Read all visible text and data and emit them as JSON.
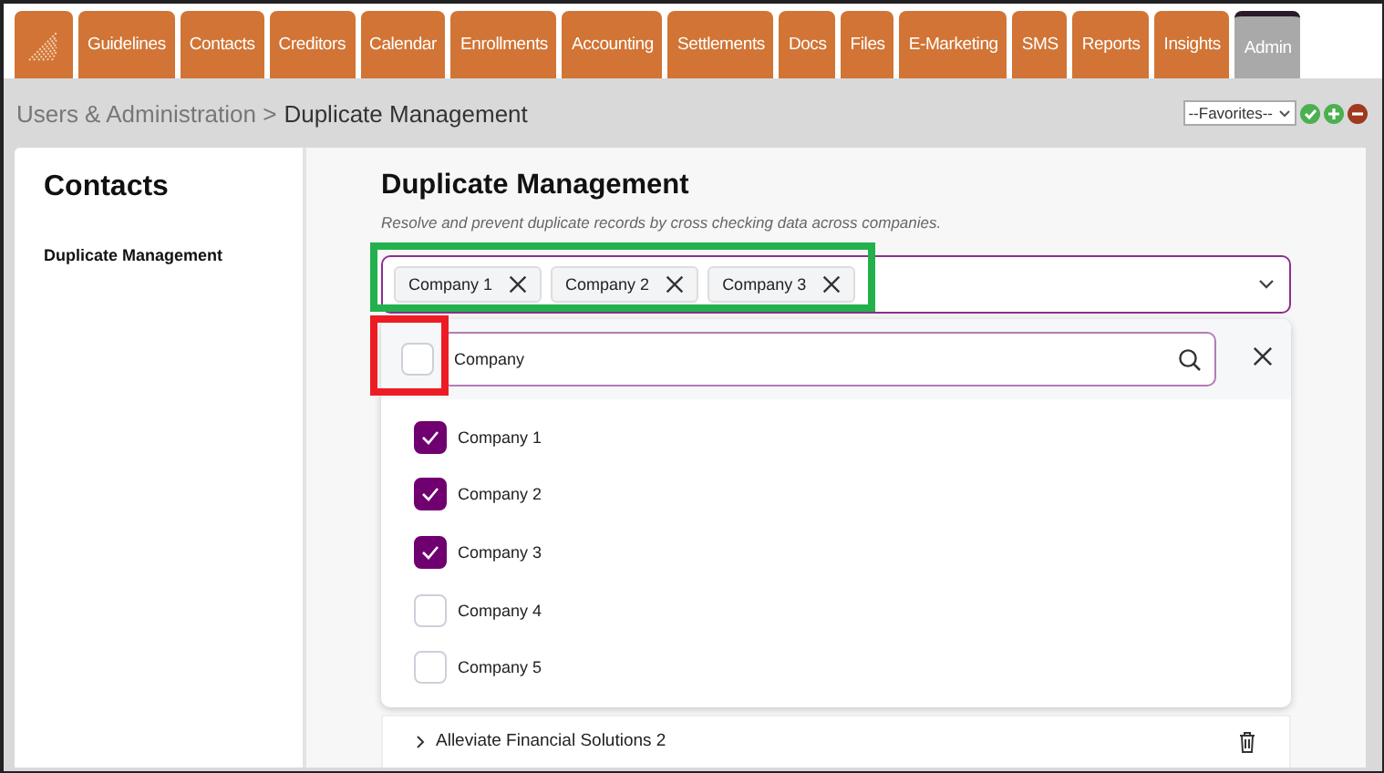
{
  "nav_tabs": [
    {
      "label": "Guidelines",
      "selected": false
    },
    {
      "label": "Contacts",
      "selected": false
    },
    {
      "label": "Creditors",
      "selected": false
    },
    {
      "label": "Calendar",
      "selected": false
    },
    {
      "label": "Enrollments",
      "selected": false
    },
    {
      "label": "Accounting",
      "selected": false
    },
    {
      "label": "Settlements",
      "selected": false
    },
    {
      "label": "Docs",
      "selected": false
    },
    {
      "label": "Files",
      "selected": false
    },
    {
      "label": "E-Marketing",
      "selected": false
    },
    {
      "label": "SMS",
      "selected": false
    },
    {
      "label": "Reports",
      "selected": false
    },
    {
      "label": "Insights",
      "selected": false
    },
    {
      "label": "Admin",
      "selected": true
    }
  ],
  "breadcrumb": {
    "parent": "Users & Administration >",
    "current": "Duplicate Management"
  },
  "favorites": {
    "value": "--Favorites--"
  },
  "sidebar": {
    "title": "Contacts",
    "items": [
      {
        "label": "Duplicate Management",
        "selected": true
      }
    ]
  },
  "main": {
    "title": "Duplicate Management",
    "subtitle": "Resolve and prevent duplicate records by cross checking data across companies.",
    "chips": [
      {
        "label": "Company 1"
      },
      {
        "label": "Company 2"
      },
      {
        "label": "Company 3"
      }
    ],
    "dropdown": {
      "select_all": {
        "checked": false
      },
      "search": {
        "value": "Company"
      },
      "options": [
        {
          "label": "Company 1",
          "checked": true
        },
        {
          "label": "Company 2",
          "checked": true
        },
        {
          "label": "Company 3",
          "checked": true
        },
        {
          "label": "Company 4",
          "checked": false
        },
        {
          "label": "Company 5",
          "checked": false
        }
      ]
    },
    "rows": [
      {
        "label": "Alleviate Financial Solutions 2"
      }
    ]
  }
}
